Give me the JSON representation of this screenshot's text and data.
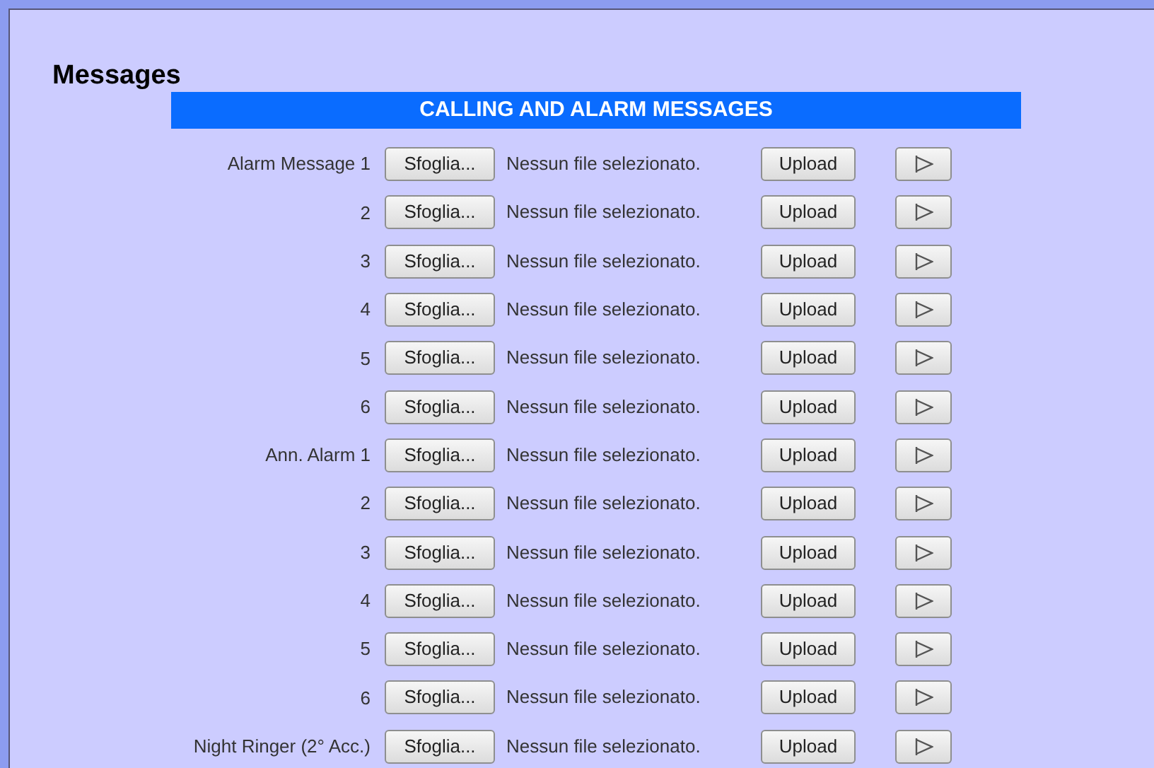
{
  "title": "Messages",
  "section": {
    "header": "CALLING AND ALARM MESSAGES",
    "rows": [
      {
        "label": "Alarm Message 1",
        "browse_button": "Sfoglia...",
        "file_status": "Nessun file selezionato.",
        "upload_button": "Upload"
      },
      {
        "label": "2",
        "browse_button": "Sfoglia...",
        "file_status": "Nessun file selezionato.",
        "upload_button": "Upload"
      },
      {
        "label": "3",
        "browse_button": "Sfoglia...",
        "file_status": "Nessun file selezionato.",
        "upload_button": "Upload"
      },
      {
        "label": "4",
        "browse_button": "Sfoglia...",
        "file_status": "Nessun file selezionato.",
        "upload_button": "Upload"
      },
      {
        "label": "5",
        "browse_button": "Sfoglia...",
        "file_status": "Nessun file selezionato.",
        "upload_button": "Upload"
      },
      {
        "label": "6",
        "browse_button": "Sfoglia...",
        "file_status": "Nessun file selezionato.",
        "upload_button": "Upload"
      },
      {
        "label": "Ann. Alarm 1",
        "browse_button": "Sfoglia...",
        "file_status": "Nessun file selezionato.",
        "upload_button": "Upload"
      },
      {
        "label": "2",
        "browse_button": "Sfoglia...",
        "file_status": "Nessun file selezionato.",
        "upload_button": "Upload"
      },
      {
        "label": "3",
        "browse_button": "Sfoglia...",
        "file_status": "Nessun file selezionato.",
        "upload_button": "Upload"
      },
      {
        "label": "4",
        "browse_button": "Sfoglia...",
        "file_status": "Nessun file selezionato.",
        "upload_button": "Upload"
      },
      {
        "label": "5",
        "browse_button": "Sfoglia...",
        "file_status": "Nessun file selezionato.",
        "upload_button": "Upload"
      },
      {
        "label": "6",
        "browse_button": "Sfoglia...",
        "file_status": "Nessun file selezionato.",
        "upload_button": "Upload"
      },
      {
        "label": "Night Ringer (2° Acc.)",
        "browse_button": "Sfoglia...",
        "file_status": "Nessun file selezionato.",
        "upload_button": "Upload"
      }
    ]
  }
}
